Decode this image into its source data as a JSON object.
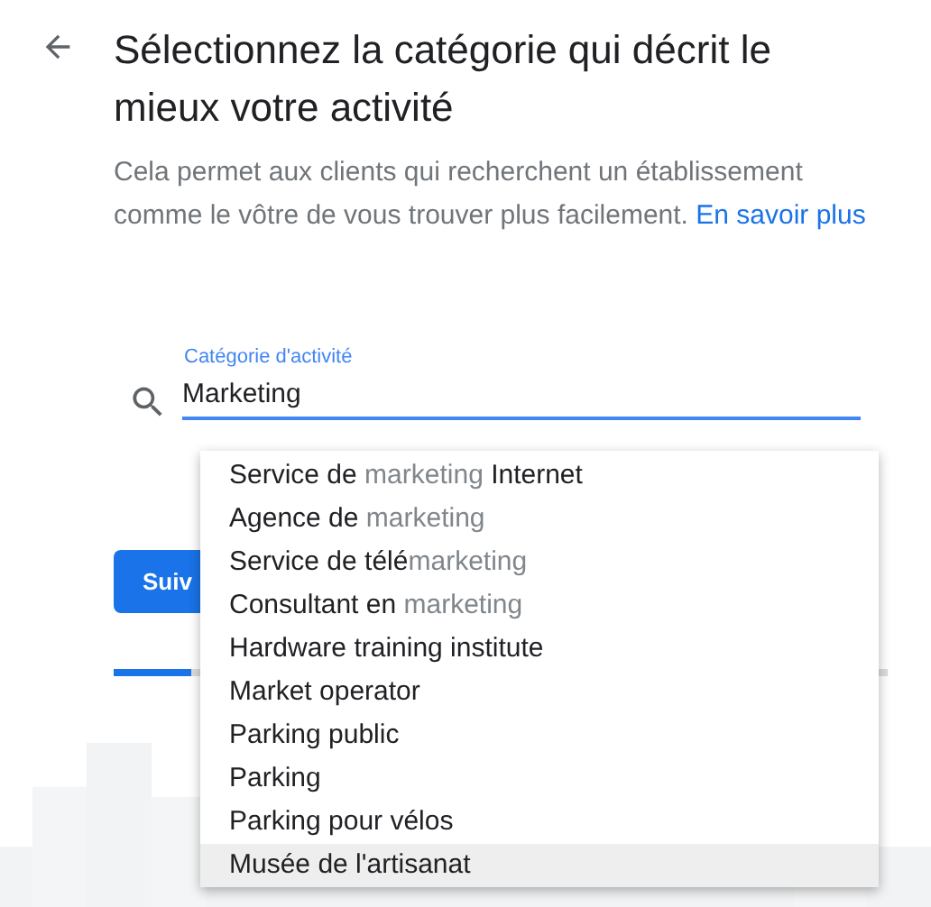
{
  "header": {
    "title": "Sélectionnez la catégorie qui décrit le mieux votre activité"
  },
  "description": {
    "text": "Cela permet aux clients qui recherchent un établissement comme le vôtre de vous trouver plus facilement.",
    "link": "En savoir plus"
  },
  "category_field": {
    "label": "Catégorie d'activité",
    "value": "Marketing"
  },
  "suggestions": [
    {
      "selected": false,
      "parts": [
        {
          "text": "Service de ",
          "match": false
        },
        {
          "text": "marketing",
          "match": true
        },
        {
          "text": " Internet",
          "match": false
        }
      ]
    },
    {
      "selected": false,
      "parts": [
        {
          "text": "Agence de ",
          "match": false
        },
        {
          "text": "marketing",
          "match": true
        }
      ]
    },
    {
      "selected": false,
      "parts": [
        {
          "text": "Service de télé",
          "match": false
        },
        {
          "text": "marketing",
          "match": true
        }
      ]
    },
    {
      "selected": false,
      "parts": [
        {
          "text": "Consultant en ",
          "match": false
        },
        {
          "text": "marketing",
          "match": true
        }
      ]
    },
    {
      "selected": false,
      "parts": [
        {
          "text": "Hardware training institute",
          "match": false
        }
      ]
    },
    {
      "selected": false,
      "parts": [
        {
          "text": "Market operator",
          "match": false
        }
      ]
    },
    {
      "selected": false,
      "parts": [
        {
          "text": "Parking public",
          "match": false
        }
      ]
    },
    {
      "selected": false,
      "parts": [
        {
          "text": "Parking",
          "match": false
        }
      ]
    },
    {
      "selected": false,
      "parts": [
        {
          "text": "Parking pour vélos",
          "match": false
        }
      ]
    },
    {
      "selected": true,
      "parts": [
        {
          "text": "Musée de l'artisanat",
          "match": false
        }
      ]
    }
  ],
  "next_button": {
    "label": "Suiv"
  },
  "progress": {
    "level": 0.1
  }
}
